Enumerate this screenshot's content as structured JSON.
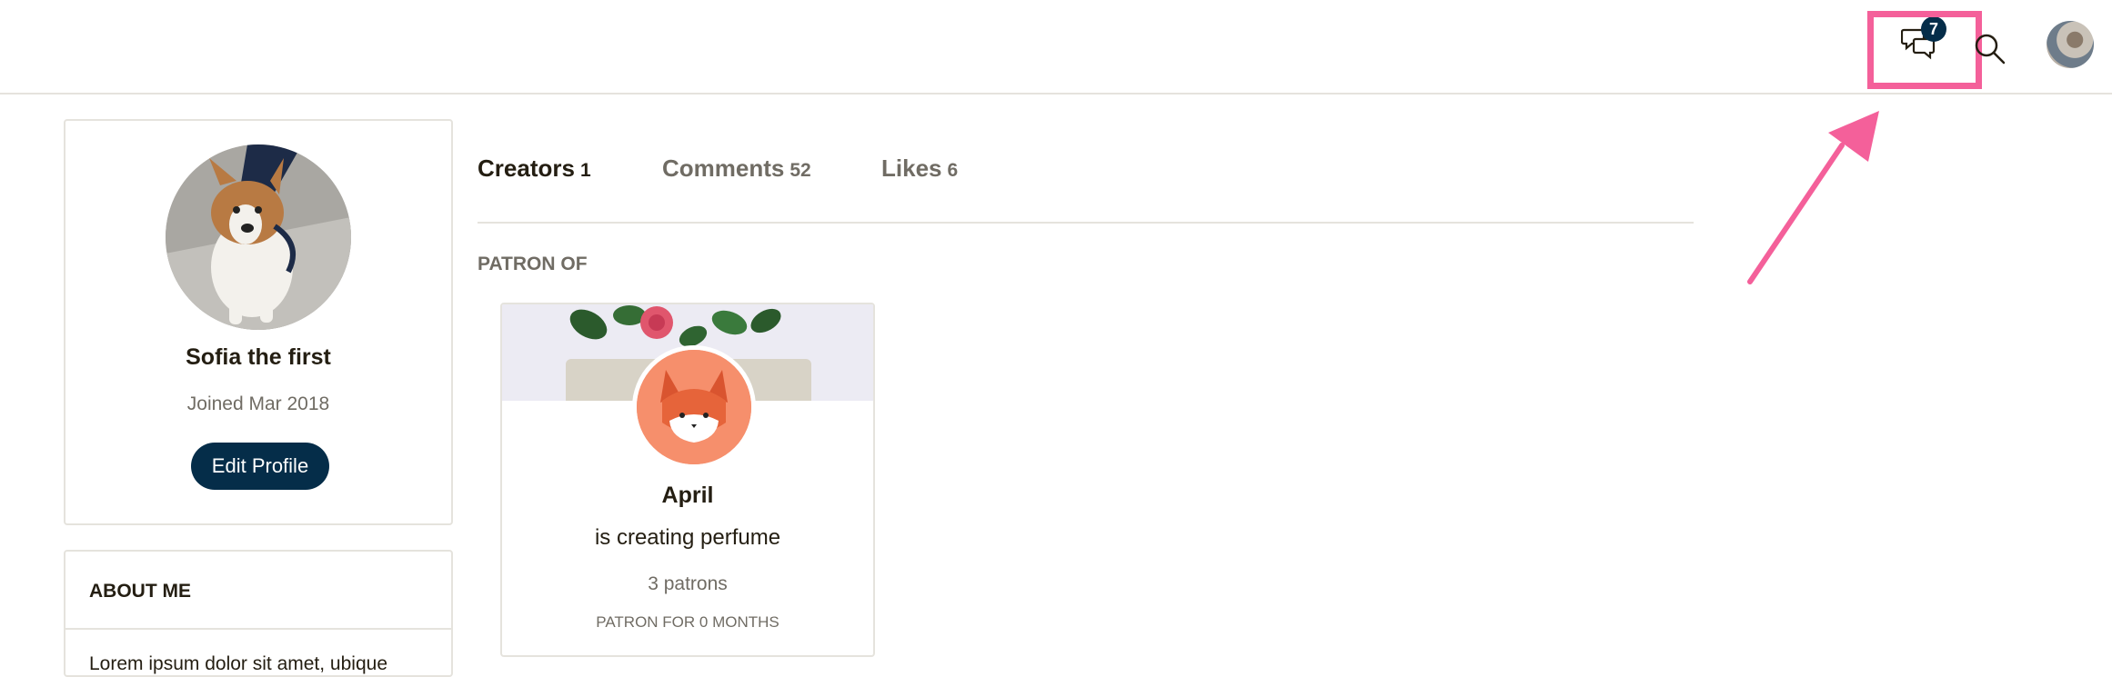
{
  "header": {
    "messages_badge": "7",
    "highlight_color": "#f4609a"
  },
  "profile": {
    "name": "Sofia the first",
    "joined": "Joined Mar 2018",
    "edit_label": "Edit Profile"
  },
  "about": {
    "title": "ABOUT ME",
    "text": "Lorem ipsum dolor sit amet, ubique"
  },
  "tabs": [
    {
      "label": "Creators",
      "count": "1",
      "active": true
    },
    {
      "label": "Comments",
      "count": "52",
      "active": false
    },
    {
      "label": "Likes",
      "count": "6",
      "active": false
    }
  ],
  "section": {
    "label": "PATRON OF"
  },
  "creator": {
    "name": "April",
    "description": "is creating perfume",
    "patrons": "3 patrons",
    "duration": "PATRON FOR 0 MONTHS"
  },
  "colors": {
    "brand_navy": "#052d49",
    "accent_pink": "#f4609a",
    "muted_text": "#706c64"
  },
  "icons": [
    "messages-icon",
    "search-icon",
    "arrow-annotation-icon"
  ]
}
